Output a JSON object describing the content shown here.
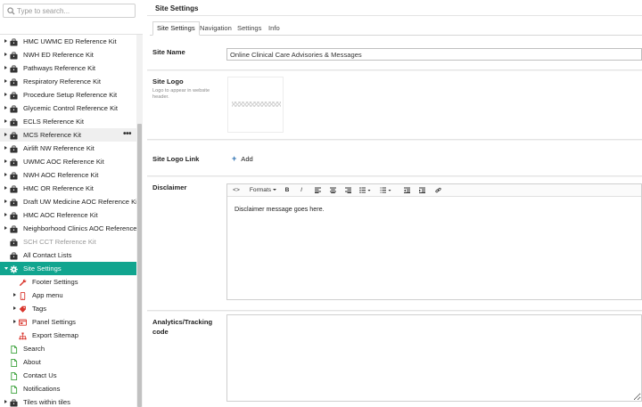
{
  "search": {
    "placeholder": "Type to search..."
  },
  "tree": [
    {
      "label": "HMC UWMC ED Reference Kit",
      "level": 0,
      "icon": "toolkit-icon",
      "arrow": "right"
    },
    {
      "label": "NWH ED Reference Kit",
      "level": 0,
      "icon": "toolkit-icon",
      "arrow": "right"
    },
    {
      "label": "Pathways Reference Kit",
      "level": 0,
      "icon": "toolkit-icon",
      "arrow": "right"
    },
    {
      "label": "Respiratory Reference Kit",
      "level": 0,
      "icon": "toolkit-icon",
      "arrow": "right"
    },
    {
      "label": "Procedure Setup Reference Kit",
      "level": 0,
      "icon": "toolkit-icon",
      "arrow": "right"
    },
    {
      "label": "Glycemic Control Reference Kit",
      "level": 0,
      "icon": "toolkit-icon",
      "arrow": "right"
    },
    {
      "label": "ECLS Reference Kit",
      "level": 0,
      "icon": "toolkit-icon",
      "arrow": "right"
    },
    {
      "label": "MCS Reference Kit",
      "level": 0,
      "icon": "toolkit-icon",
      "arrow": "right",
      "state": "hover",
      "more": "•••"
    },
    {
      "label": "Airlift NW Reference Kit",
      "level": 0,
      "icon": "toolkit-icon",
      "arrow": "right"
    },
    {
      "label": "UWMC AOC Reference Kit",
      "level": 0,
      "icon": "toolkit-icon",
      "arrow": "right"
    },
    {
      "label": "NWH AOC Reference Kit",
      "level": 0,
      "icon": "toolkit-icon",
      "arrow": "right"
    },
    {
      "label": "HMC OR Reference Kit",
      "level": 0,
      "icon": "toolkit-icon",
      "arrow": "right"
    },
    {
      "label": "Draft UW Medicine AOC Reference Kit",
      "level": 0,
      "icon": "toolkit-icon",
      "arrow": "right"
    },
    {
      "label": "HMC AOC Reference Kit",
      "level": 0,
      "icon": "toolkit-icon",
      "arrow": "right"
    },
    {
      "label": "Neighborhood Clinics AOC Reference Kit",
      "level": 0,
      "icon": "toolkit-icon",
      "arrow": "right"
    },
    {
      "label": "SCH CCT Reference Kit",
      "level": 0,
      "icon": "toolkit-icon",
      "arrow": "none",
      "state": "muted"
    },
    {
      "label": "All Contact Lists",
      "level": 0,
      "icon": "toolkit-icon",
      "arrow": "none"
    },
    {
      "label": "Site Settings",
      "level": 0,
      "icon": "gear-icon",
      "arrow": "down",
      "state": "active"
    },
    {
      "label": "Footer Settings",
      "level": 1,
      "icon": "wrench-icon",
      "arrow": "none"
    },
    {
      "label": "App menu",
      "level": 1,
      "icon": "mobile-icon",
      "arrow": "right"
    },
    {
      "label": "Tags",
      "level": 1,
      "icon": "tags-icon",
      "arrow": "right"
    },
    {
      "label": "Panel Settings",
      "level": 1,
      "icon": "panel-settings-icon",
      "arrow": "right"
    },
    {
      "label": "Export Sitemap",
      "level": 1,
      "icon": "sitemap-icon",
      "arrow": "none"
    },
    {
      "label": "Search",
      "level": 0,
      "icon": "page-icon",
      "arrow": "none"
    },
    {
      "label": "About",
      "level": 0,
      "icon": "page-icon",
      "arrow": "none"
    },
    {
      "label": "Contact Us",
      "level": 0,
      "icon": "page-icon",
      "arrow": "none"
    },
    {
      "label": "Notifications",
      "level": 0,
      "icon": "page-icon",
      "arrow": "none"
    },
    {
      "label": "Tiles within tiles",
      "level": 0,
      "icon": "toolkit-icon",
      "arrow": "right"
    }
  ],
  "main": {
    "title": "Site Settings",
    "tabs": [
      "Site Settings",
      "Navigation",
      "Settings",
      "Info"
    ],
    "active_tab": "Site Settings"
  },
  "fields": {
    "site_name_label": "Site Name",
    "site_name_value": "Online Clinical Care Advisories & Messages",
    "site_logo_label": "Site Logo",
    "site_logo_help": "Logo to appear in website header.",
    "site_logo_link_label": "Site Logo Link",
    "add_label": "Add",
    "disclaimer_label": "Disclaimer",
    "disclaimer_text": "Disclaimer message goes here.",
    "analytics_label": "Analytics/Tracking code"
  },
  "editor_toolbar": {
    "source": "<>",
    "formats": "Formats",
    "bold": "B",
    "italic": "I"
  },
  "colors": {
    "accent": "#11a58f",
    "toolkit_icon": "#333333",
    "page_icon": "#3aa13a",
    "tool_icon_red": "#d9342b",
    "link_blue": "#2a6fb0"
  }
}
